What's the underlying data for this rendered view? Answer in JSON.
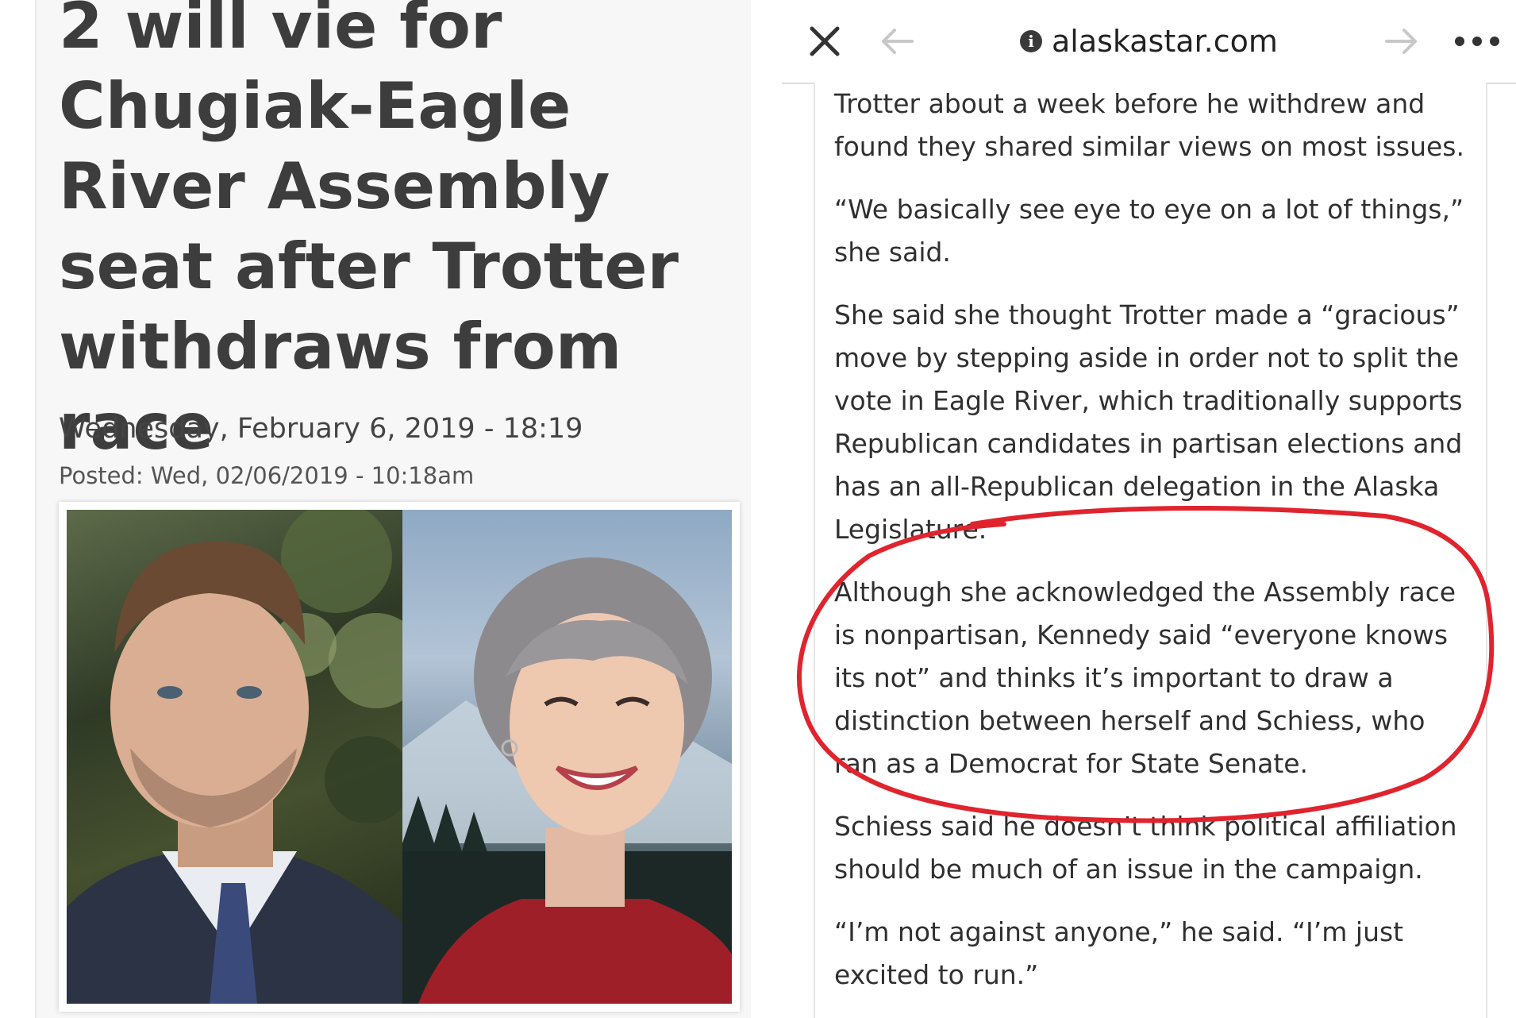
{
  "article": {
    "headline": "2 will vie for Chugiak-Eagle River Assembly seat after Trotter withdraws from race",
    "date": "Wednesday, February 6, 2019 - 18:19",
    "posted": "Posted: Wed, 02/06/2019 - 10:18am"
  },
  "browser": {
    "url": "alaskastar.com"
  },
  "content": {
    "paragraphs": [
      "Trotter about a week before he withdrew and found they shared similar views on most issues.",
      "“We basically see eye to eye on a lot of things,” she said.",
      "She said she thought Trotter made a “gracious” move by stepping aside in order not to split the vote in Eagle River, which traditionally supports Republican candidates in partisan elections and has an all-Republican delegation in the Alaska Legislature.",
      "Although she acknowledged the Assembly race is nonpartisan, Kennedy said “everyone knows its not” and thinks it’s important to draw a distinction between herself and Schiess, who ran as a Democrat for State Senate.",
      "Schiess said he doesn’t think political affiliation should be much of an issue in the campaign.",
      "“I’m not against anyone,” he said. “I’m just excited to run.”"
    ]
  },
  "icons": {
    "close": "close-icon",
    "back": "back-arrow-icon",
    "forward": "forward-arrow-icon",
    "info": "info-icon",
    "more": "more-dots-icon"
  },
  "colors": {
    "headline": "#3d3d3d",
    "annotation": "#e0242e",
    "body_text": "#303030"
  }
}
